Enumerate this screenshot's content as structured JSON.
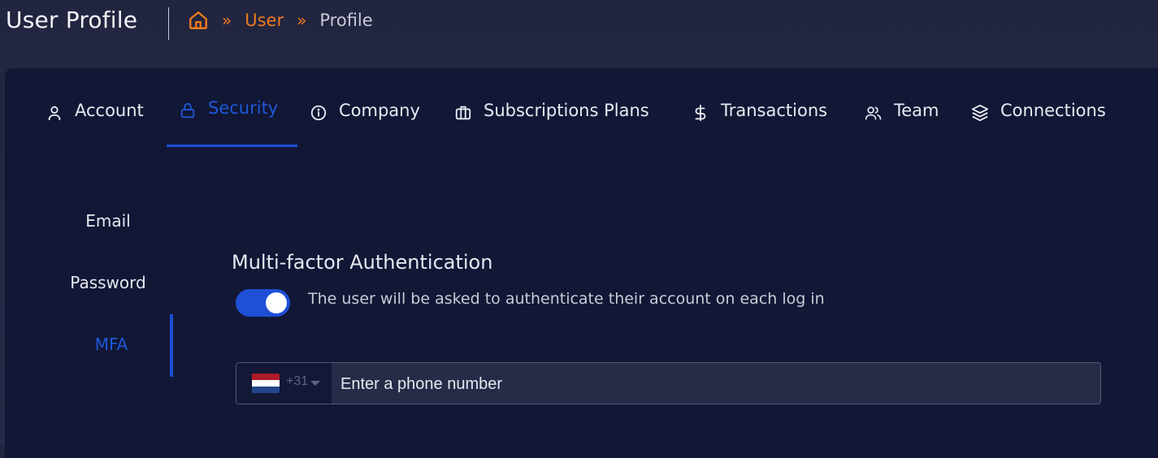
{
  "header": {
    "title": "User Profile",
    "breadcrumb": {
      "home_icon": "home-icon",
      "separator": "»",
      "items": [
        "User",
        "Profile"
      ]
    }
  },
  "tabs": [
    {
      "label": "Account",
      "icon": "user-icon",
      "active": false
    },
    {
      "label": "Security",
      "icon": "lock-icon",
      "active": true
    },
    {
      "label": "Company",
      "icon": "info-icon",
      "active": false
    },
    {
      "label": "Subscriptions Plans",
      "icon": "briefcase-icon",
      "active": false
    },
    {
      "label": "Transactions",
      "icon": "dollar-icon",
      "active": false
    },
    {
      "label": "Team",
      "icon": "users-icon",
      "active": false
    },
    {
      "label": "Connections",
      "icon": "layers-icon",
      "active": false
    }
  ],
  "side_menu": [
    {
      "label": "Email",
      "active": false
    },
    {
      "label": "Password",
      "active": false
    },
    {
      "label": "MFA",
      "active": true
    }
  ],
  "mfa": {
    "title": "Multi-factor Authentication",
    "toggle_on": true,
    "description": "The user will be asked to authenticate their account on each log in",
    "phone": {
      "country_flag": "netherlands-flag",
      "dial_code": "+31",
      "placeholder": "Enter a phone number",
      "value": ""
    }
  },
  "colors": {
    "accent": "#1f4fd6",
    "breadcrumb": "#f07a1e",
    "card_bg": "#111735",
    "page_bg": "#22253f"
  }
}
